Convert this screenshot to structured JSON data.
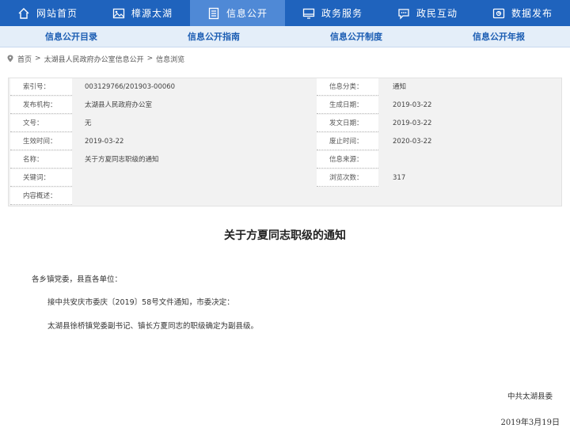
{
  "nav": {
    "items": [
      {
        "label": "网站首页",
        "icon": "home-icon"
      },
      {
        "label": "樟源太湖",
        "icon": "image-icon"
      },
      {
        "label": "信息公开",
        "icon": "document-icon",
        "active": true
      },
      {
        "label": "政务服务",
        "icon": "monitor-icon"
      },
      {
        "label": "政民互动",
        "icon": "chat-icon"
      },
      {
        "label": "数据发布",
        "icon": "data-icon"
      }
    ]
  },
  "subnav": {
    "items": [
      "信息公开目录",
      "信息公开指南",
      "信息公开制度",
      "信息公开年报"
    ]
  },
  "breadcrumb": {
    "home": "首页",
    "level1": "太湖县人民政府办公室信息公开",
    "level2": "信息浏览",
    "separator": ">"
  },
  "info": {
    "rows": [
      {
        "label_left": "索引号：",
        "value_left": "003129766/201903-00060",
        "label_right": "信息分类：",
        "value_right": "通知"
      },
      {
        "label_left": "发布机构：",
        "value_left": "太湖县人民政府办公室",
        "label_right": "生成日期：",
        "value_right": "2019-03-22"
      },
      {
        "label_left": "文号：",
        "value_left": "无",
        "label_right": "发文日期：",
        "value_right": "2019-03-22"
      },
      {
        "label_left": "生效时间：",
        "value_left": "2019-03-22",
        "label_right": "废止时间：",
        "value_right": "2020-03-22"
      },
      {
        "label_left": "名称：",
        "value_left": "关于方夏同志职级的通知",
        "label_right": "信息来源：",
        "value_right": ""
      },
      {
        "label_left": "关键词：",
        "value_left": "",
        "label_right": "浏览次数：",
        "value_right": "317"
      },
      {
        "label_left": "内容概述：",
        "value_left": ""
      }
    ]
  },
  "article": {
    "title": "关于方夏同志职级的通知",
    "salutation": "各乡镇党委，县直各单位：",
    "body1": "接中共安庆市委庆〔2019〕58号文件通知，市委决定：",
    "body2": "太湖县徐桥镇党委副书记、镇长方夏同志的职级确定为副县级。",
    "signature": "中共太湖县委",
    "date": "2019年3月19日"
  }
}
